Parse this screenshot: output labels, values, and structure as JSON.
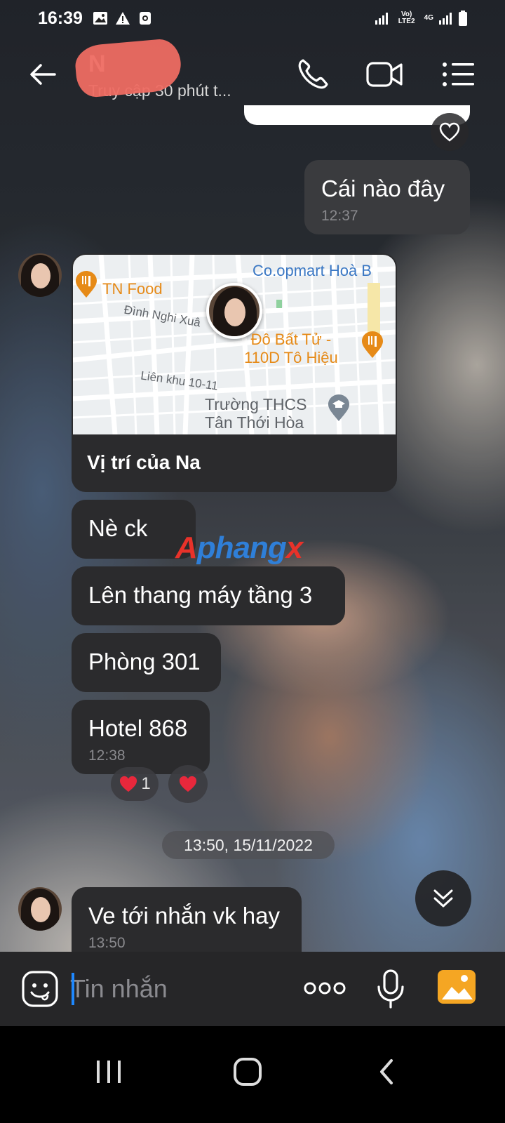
{
  "status_bar": {
    "time": "16:39",
    "network_label": "Vo) LTE2",
    "network_type": "4G"
  },
  "header": {
    "contact_name": "N",
    "contact_status": "Truy cập 30 phút t..."
  },
  "messages": {
    "sent_1": {
      "text": "Cái nào đây",
      "time": "12:37"
    },
    "location": {
      "title": "Vị trí của Na",
      "map": {
        "poi_tn_food": "TN Food",
        "poi_coopmart": "Co.opmart Hoà B",
        "street_dinh_nghi_xuan": "Đình Nghi Xuâ",
        "poi_do_bat_tu_line1": "Đô Bất Tử -",
        "poi_do_bat_tu_line2": "110D Tô Hiệu",
        "street_lien_khu": "Liên khu 10-11",
        "poi_school_line1": "Trường THCS",
        "poi_school_line2": "Tân Thới Hòa"
      }
    },
    "recv_1": {
      "text": "Nè ck"
    },
    "recv_2": {
      "text": "Lên thang máy tầng 3"
    },
    "recv_3": {
      "text": "Phòng 301"
    },
    "recv_4": {
      "text": "Hotel 868",
      "time": "12:38",
      "reaction_count": "1"
    },
    "date_separator": "13:50, 15/11/2022",
    "recv_5": {
      "text": "Ve tới nhắn vk hay",
      "time": "13:50"
    }
  },
  "watermark": {
    "part_a": "A",
    "part_b": "phang",
    "part_c": "x"
  },
  "composer": {
    "placeholder": "Tin nhắn"
  },
  "colors": {
    "bubble": "#2b2b2d",
    "accent_blue": "#1e88ff",
    "heart": "#e8283c",
    "gallery_orange": "#f5a623"
  }
}
